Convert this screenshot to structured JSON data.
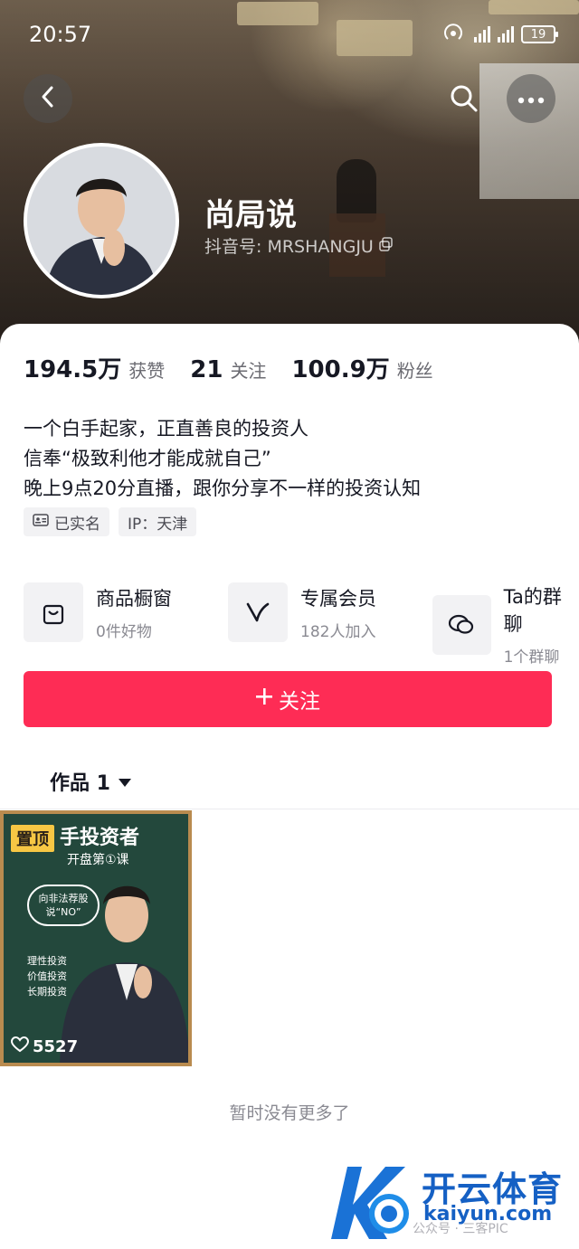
{
  "status_bar": {
    "time": "20:57",
    "battery": "19"
  },
  "profile": {
    "name": "尚局说",
    "douyin_id": "抖音号: MRSHANGJU"
  },
  "stats": [
    {
      "value": "194.5万",
      "label": "获赞"
    },
    {
      "value": "21",
      "label": "关注"
    },
    {
      "value": "100.9万",
      "label": "粉丝"
    }
  ],
  "bio": [
    "一个白手起家，正直善良的投资人",
    "信奉“极致利他才能成就自己”",
    "晚上9点20分直播，跟你分享不一样的投资认知"
  ],
  "tags": {
    "verified": "已实名",
    "ip": "IP：天津"
  },
  "services": [
    {
      "title": "商品橱窗",
      "subtitle": "0件好物",
      "icon": "shopping-bag-icon"
    },
    {
      "title": "专属会员",
      "subtitle": "182人加入",
      "icon": "v-member-icon"
    },
    {
      "title": "Ta的群聊",
      "subtitle": "1个群聊",
      "icon": "chat-bubbles-icon"
    }
  ],
  "follow_button": {
    "label": "关注"
  },
  "works_tab": {
    "label": "作品 1"
  },
  "video": {
    "pinned": "置顶",
    "title": "手投资者",
    "subtitle": "开盘第①课",
    "bubble": "向非法荐股 说“NO”",
    "side": [
      "理性投资",
      "价值投资",
      "长期投资"
    ],
    "likes": "5527"
  },
  "no_more": "暂时没有更多了",
  "watermark": {
    "brand": "开云体育",
    "url": "kaiyun.com",
    "account": "公众号 · 三客PIC"
  },
  "colors": {
    "accent": "#fe2c55"
  }
}
